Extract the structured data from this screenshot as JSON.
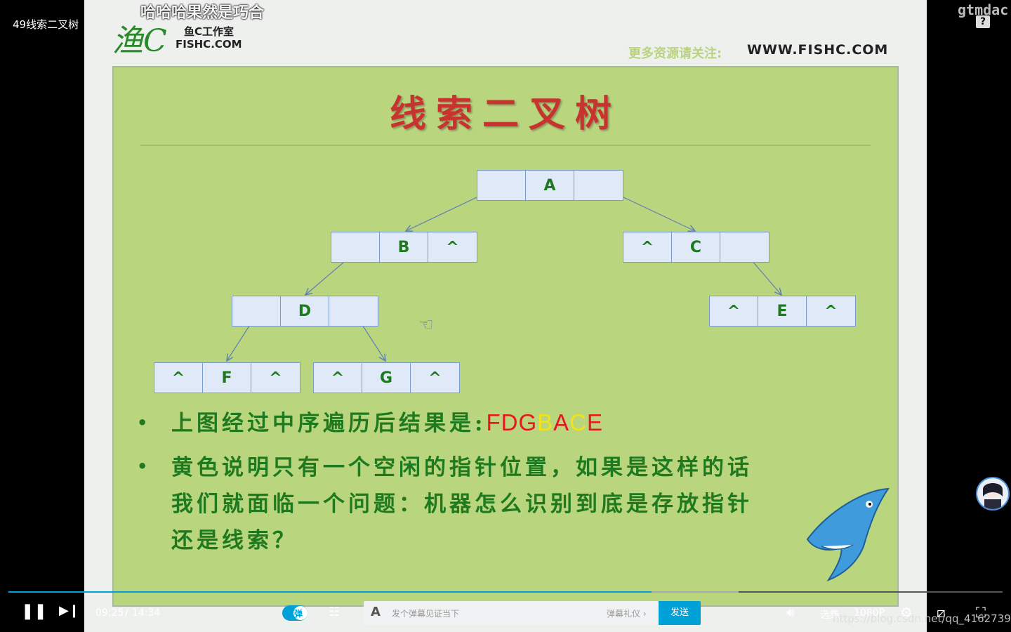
{
  "player": {
    "video_title": "49线索二叉树",
    "danmaku_text": "哈哈哈果然是巧合",
    "watermark": "gtmdac",
    "help_label": "?",
    "time_current": "09:25",
    "time_separator": "/",
    "time_total": "14:34",
    "progress": 0.647,
    "danmaku_toggle_label": "弹",
    "danmaku_placeholder": "发个弹幕见证当下",
    "danmaku_etiquette": "弹幕礼仪 ›",
    "send_label": "发送",
    "episodes_label": "选集",
    "quality_label": "1080P",
    "blog_url": "https://blog.csdn.net/qq_41627390",
    "accent_color": "#00a1d6"
  },
  "slide": {
    "logo_cn": "鱼C工作室",
    "logo_en": "FISHC.COM",
    "more_resources": "更多资源请关注:",
    "site_url": "WWW.FISHC.COM",
    "title": "线索二叉树",
    "nodes": [
      {
        "id": "A",
        "cells": [
          "",
          "A",
          ""
        ]
      },
      {
        "id": "B",
        "cells": [
          "",
          "B",
          "^"
        ]
      },
      {
        "id": "C",
        "cells": [
          "^",
          "C",
          ""
        ]
      },
      {
        "id": "D",
        "cells": [
          "",
          "D",
          ""
        ]
      },
      {
        "id": "E",
        "cells": [
          "^",
          "E",
          "^"
        ]
      },
      {
        "id": "F",
        "cells": [
          "^",
          "F",
          "^"
        ]
      },
      {
        "id": "G",
        "cells": [
          "^",
          "G",
          "^"
        ]
      }
    ],
    "bullet1_text": "上图经过中序遍历后结果是:",
    "sequence": [
      {
        "ch": "F",
        "color": "#e8171f"
      },
      {
        "ch": "D",
        "color": "#e8171f"
      },
      {
        "ch": "G",
        "color": "#e8171f"
      },
      {
        "ch": "B",
        "color": "#f2e21a"
      },
      {
        "ch": "A",
        "color": "#e8171f"
      },
      {
        "ch": "C",
        "color": "#f2e21a"
      },
      {
        "ch": "E",
        "color": "#e8171f"
      }
    ],
    "bullet2_line1": "黄色说明只有一个空闲的指针位置，如果是这样的话",
    "bullet2_line2": "我们就面临一个问题：机器怎么识别到底是存放指针",
    "bullet2_line3": "还是线索？"
  }
}
